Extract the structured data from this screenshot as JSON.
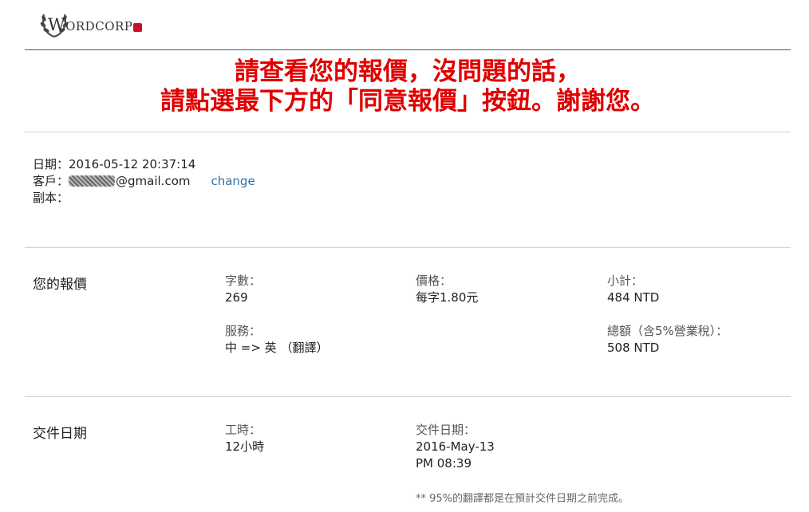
{
  "logo": {
    "text_first": "W",
    "text_rest": "ORDCORP"
  },
  "banner": {
    "line1": "請查看您的報價，沒問題的話，",
    "line2": "請點選最下方的「同意報價」按鈕。謝謝您。"
  },
  "meta": {
    "date_label": "日期：",
    "date_value": "2016-05-12 20:37:14",
    "client_label": "客戶：",
    "client_email_domain": "@gmail.com",
    "change_link": "change",
    "cc_label": "副本："
  },
  "quote": {
    "section_title": "您的報價",
    "word_count_label": "字數：",
    "word_count_value": "269",
    "price_label": "價格：",
    "price_value": "每字1.80元",
    "subtotal_label": "小計：",
    "subtotal_value": "484 NTD",
    "service_label": "服務：",
    "service_value": "中 => 英 （翻譯）",
    "total_label": "總額（含5%營業稅）：",
    "total_value": "508 NTD"
  },
  "delivery": {
    "section_title": "交件日期",
    "hours_label": "工時：",
    "hours_value": "12小時",
    "date_label": "交件日期：",
    "date_value_line1": "2016-May-13",
    "date_value_line2": "PM 08:39",
    "note": "** 95%的翻譯都是在預計交件日期之前完成。"
  }
}
